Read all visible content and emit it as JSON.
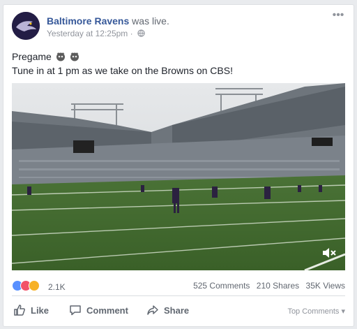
{
  "post": {
    "page_name": "Baltimore Ravens",
    "status_suffix": "was live.",
    "timestamp": "Yesterday at 12:25pm",
    "separator": "·",
    "line1": "Pregame",
    "line2": "Tune in at 1 pm as we take on the Browns on CBS!",
    "more_glyph": "•••"
  },
  "stats": {
    "reactions_count": "2.1K",
    "comments": "525 Comments",
    "shares": "210 Shares",
    "views": "35K Views"
  },
  "actions": {
    "like": "Like",
    "comment": "Comment",
    "share": "Share",
    "top_comments": "Top Comments ▾"
  },
  "colors": {
    "link": "#365899",
    "reaction_like": "#5890ff",
    "reaction_love": "#f25268",
    "reaction_wow": "#f7b125",
    "field": "#3f6b2f"
  },
  "icons": [
    "ravens-logo-icon",
    "globe-icon",
    "ravens-emoji-icon",
    "mute-icon",
    "like-icon",
    "comment-icon",
    "share-icon"
  ]
}
